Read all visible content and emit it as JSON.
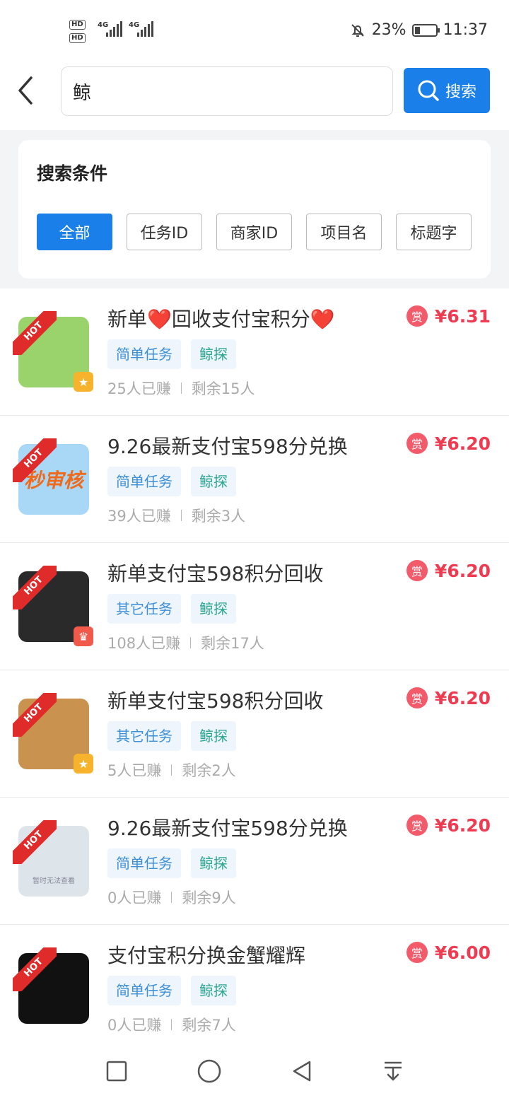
{
  "status_bar": {
    "hd1": "HD",
    "hd2": "HD",
    "net1": "4G",
    "net2": "4G",
    "battery_pct": "23%",
    "time": "11:37"
  },
  "search": {
    "query": "鲸",
    "button_label": "搜索"
  },
  "filter": {
    "title": "搜索条件",
    "chips": [
      "全部",
      "任务ID",
      "商家ID",
      "项目名",
      "标题字"
    ],
    "active_index": 0
  },
  "tasks": [
    {
      "title": "新单❤️回收支付宝积分❤️",
      "type_tag": "简单任务",
      "source_tag": "鲸探",
      "earned": "25人已赚",
      "remaining": "剩余15人",
      "reward": "¥6.31",
      "badge": "star",
      "thumb_color": "#9ad36b",
      "hot": "HOT"
    },
    {
      "title": "9.26最新支付宝598分兑换",
      "type_tag": "简单任务",
      "source_tag": "鲸探",
      "earned": "39人已赚",
      "remaining": "剩余3人",
      "reward": "¥6.20",
      "badge": "",
      "thumb_color": "#a9d8f6",
      "thumb_text": "秒审核",
      "hot": "HOT"
    },
    {
      "title": "新单支付宝598积分回收",
      "type_tag": "其它任务",
      "source_tag": "鲸探",
      "earned": "108人已赚",
      "remaining": "剩余17人",
      "reward": "¥6.20",
      "badge": "crown",
      "thumb_color": "#2a2a2a",
      "hot": "HOT"
    },
    {
      "title": "新单支付宝598积分回收",
      "type_tag": "其它任务",
      "source_tag": "鲸探",
      "earned": "5人已赚",
      "remaining": "剩余2人",
      "reward": "¥6.20",
      "badge": "star",
      "thumb_color": "#c9924f",
      "hot": "HOT"
    },
    {
      "title": "9.26最新支付宝598分兑换",
      "type_tag": "简单任务",
      "source_tag": "鲸探",
      "earned": "0人已赚",
      "remaining": "剩余9人",
      "reward": "¥6.20",
      "badge": "",
      "thumb_color": "#dde4ea",
      "thumb_text": "暂时无法查看",
      "hot": "HOT"
    },
    {
      "title": "支付宝积分换金蟹耀辉",
      "type_tag": "简单任务",
      "source_tag": "鲸探",
      "earned": "0人已赚",
      "remaining": "剩余7人",
      "reward": "¥6.00",
      "badge": "",
      "thumb_color": "#111111",
      "hot": "HOT"
    }
  ],
  "reward_icon_label": "赏",
  "colors": {
    "primary": "#1a7fe8",
    "price": "#ee3b52",
    "hot": "#e02b2b"
  }
}
